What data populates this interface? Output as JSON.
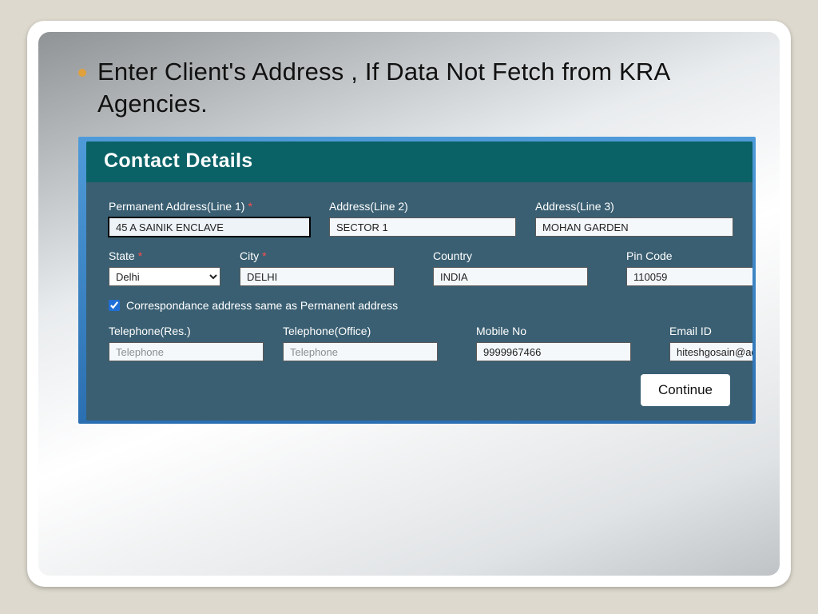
{
  "slide": {
    "bullet_text": "Enter Client's Address , If Data Not Fetch from KRA Agencies."
  },
  "form": {
    "title": "Contact Details",
    "labels": {
      "addr1": "Permanent Address(Line 1)",
      "addr2": "Address(Line 2)",
      "addr3": "Address(Line 3)",
      "state": "State",
      "city": "City",
      "country": "Country",
      "pin": "Pin Code",
      "same_as": "Correspondance address same as Permanent address",
      "tel_res": "Telephone(Res.)",
      "tel_off": "Telephone(Office)",
      "mobile": "Mobile No",
      "email": "Email ID"
    },
    "required_marker": "*",
    "values": {
      "addr1": "45 A SAINIK ENCLAVE",
      "addr2": "SECTOR 1",
      "addr3": "MOHAN GARDEN",
      "state_selected": "Delhi",
      "city": "DELHI",
      "country": "INDIA",
      "pin": "110059",
      "same_as_checked": true,
      "tel_res": "",
      "tel_off": "",
      "mobile": "9999967466",
      "email": "hiteshgosain@adroitfir"
    },
    "placeholders": {
      "telephone": "Telephone"
    },
    "buttons": {
      "continue": "Continue"
    }
  }
}
